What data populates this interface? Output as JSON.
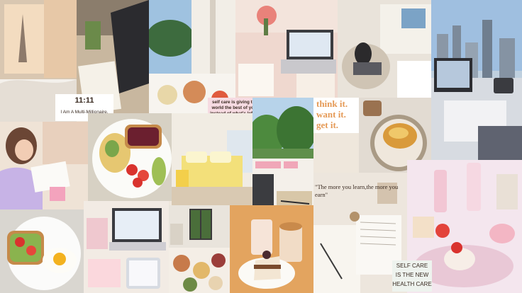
{
  "collage": {
    "captions": {
      "clock": {
        "time": "11:11",
        "line": "I Am A Multi-Millionaire."
      },
      "self_care_note": "self care is giving the world the best of you, instead of what's left of you.",
      "think_it": [
        "think it.",
        "want it.",
        "get it."
      ],
      "learn_quote": "\"The more you learn,the more you earn\"",
      "health_care": [
        "SELF CARE",
        "IS THE NEW",
        "HEALTH CARE"
      ]
    },
    "colors": {
      "background": "#efe7dc",
      "note_pink": "#f6dbe2",
      "accent_orange": "#e59a57",
      "note_mint": "#eef3ee"
    },
    "tiles": [
      {
        "name": "paris-hotel-bedroom-photo"
      },
      {
        "name": "laptop-desk-with-notebook-photo"
      },
      {
        "name": "balcony-breakfast-photo"
      },
      {
        "name": "pink-desk-with-laptop-photo"
      },
      {
        "name": "cozy-reading-chair-photo"
      },
      {
        "name": "city-view-desk-photo"
      },
      {
        "name": "girl-studying-photo"
      },
      {
        "name": "omelette-and-toast-plate-photo"
      },
      {
        "name": "yellow-bedroom-photo"
      },
      {
        "name": "green-trees-window-photo"
      },
      {
        "name": "pastry-plate-photo"
      },
      {
        "name": "planner-notebook-photo"
      },
      {
        "name": "avocado-toast-with-egg-photo"
      },
      {
        "name": "desk-with-laptop-and-tablet-photo"
      },
      {
        "name": "window-room-photo"
      },
      {
        "name": "breakfast-spread-photo"
      },
      {
        "name": "cake-and-coffee-photo"
      },
      {
        "name": "open-books-study-photo"
      },
      {
        "name": "pink-desserts-photo"
      }
    ]
  }
}
